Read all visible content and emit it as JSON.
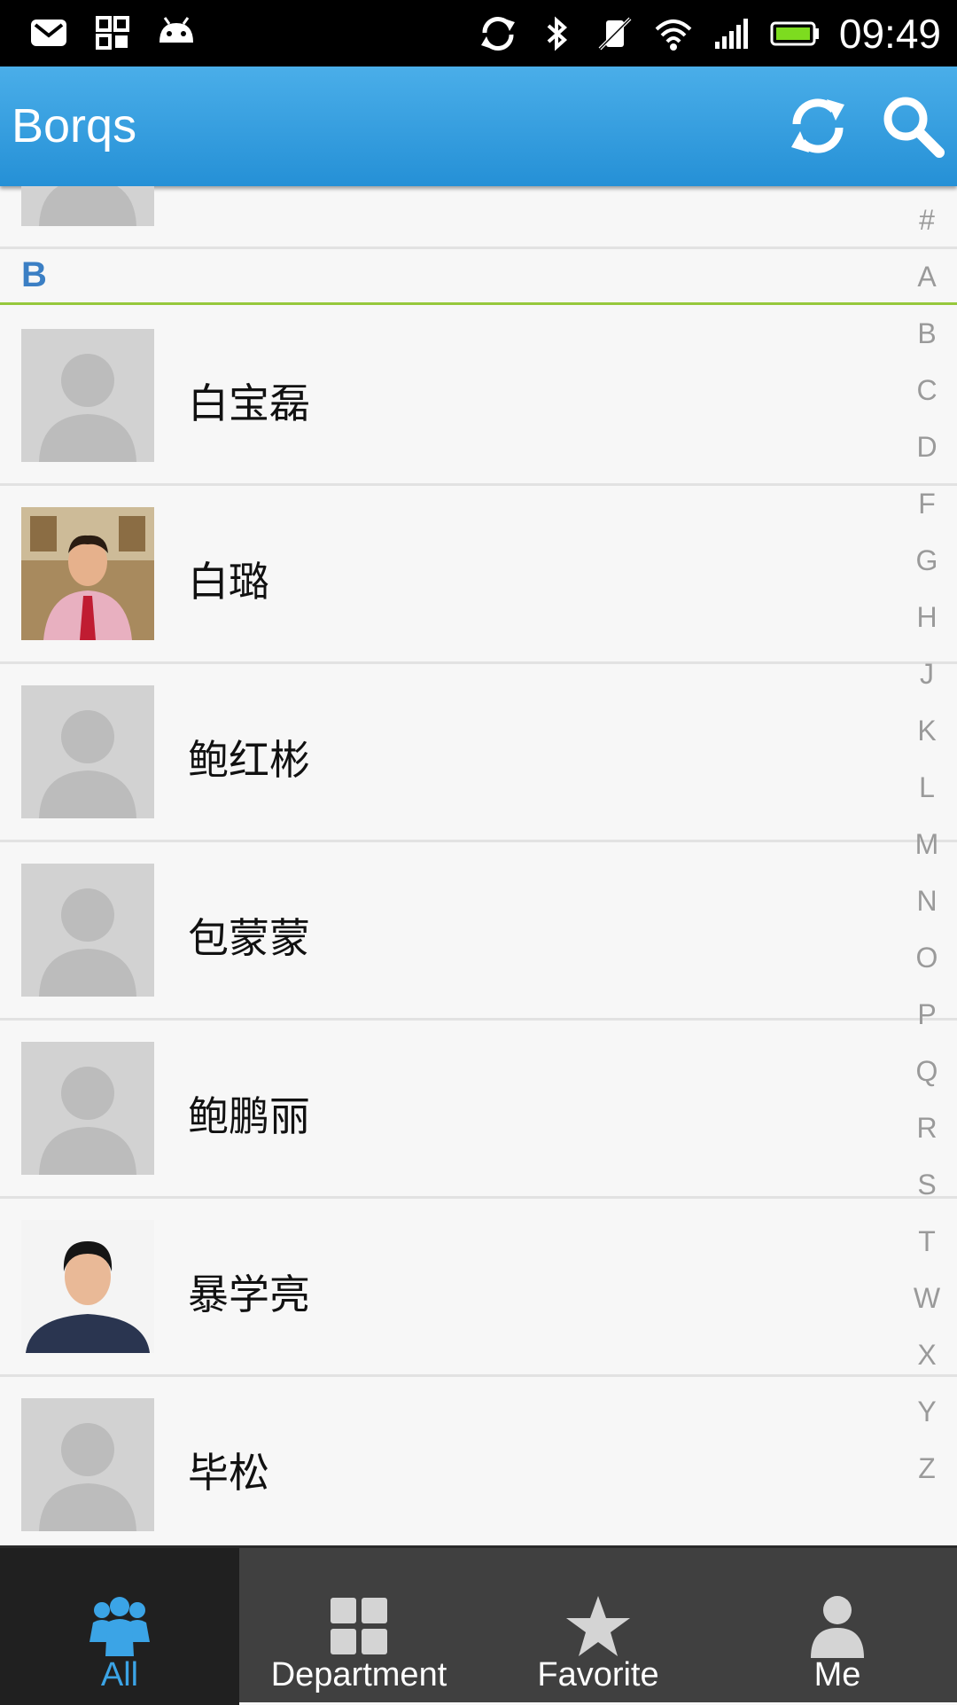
{
  "statusbar": {
    "time": "09:49",
    "left_icons": [
      "gmail-icon",
      "apps-icon",
      "android-icon"
    ],
    "right_icons": [
      "sync-icon",
      "bluetooth-icon",
      "vibrate-off-icon",
      "wifi-icon",
      "signal-icon",
      "battery-icon"
    ]
  },
  "actionbar": {
    "title": "Borqs",
    "refresh_icon": "refresh-icon",
    "search_icon": "search-icon",
    "color": "#2d9ee0"
  },
  "list": {
    "section_letter": "B",
    "contacts": [
      {
        "name": "白宝磊",
        "avatar": "placeholder"
      },
      {
        "name": "白璐",
        "avatar": "photo"
      },
      {
        "name": "鲍红彬",
        "avatar": "placeholder"
      },
      {
        "name": "包蒙蒙",
        "avatar": "placeholder"
      },
      {
        "name": "鲍鹏丽",
        "avatar": "placeholder"
      },
      {
        "name": "暴学亮",
        "avatar": "photo"
      },
      {
        "name": "毕松",
        "avatar": "placeholder"
      }
    ]
  },
  "index_letters": [
    "#",
    "A",
    "B",
    "C",
    "D",
    "F",
    "G",
    "H",
    "J",
    "K",
    "L",
    "M",
    "N",
    "O",
    "P",
    "Q",
    "R",
    "S",
    "T",
    "W",
    "X",
    "Y",
    "Z"
  ],
  "tabs": [
    {
      "label": "All",
      "icon": "people-icon",
      "active": true
    },
    {
      "label": "Department",
      "icon": "grid-icon",
      "active": false
    },
    {
      "label": "Favorite",
      "icon": "star-icon",
      "active": false
    },
    {
      "label": "Me",
      "icon": "person-icon",
      "active": false
    }
  ],
  "colors": {
    "accent": "#3ba4e6",
    "section_letter": "#3b7fc4",
    "section_divider": "#96c83c"
  }
}
